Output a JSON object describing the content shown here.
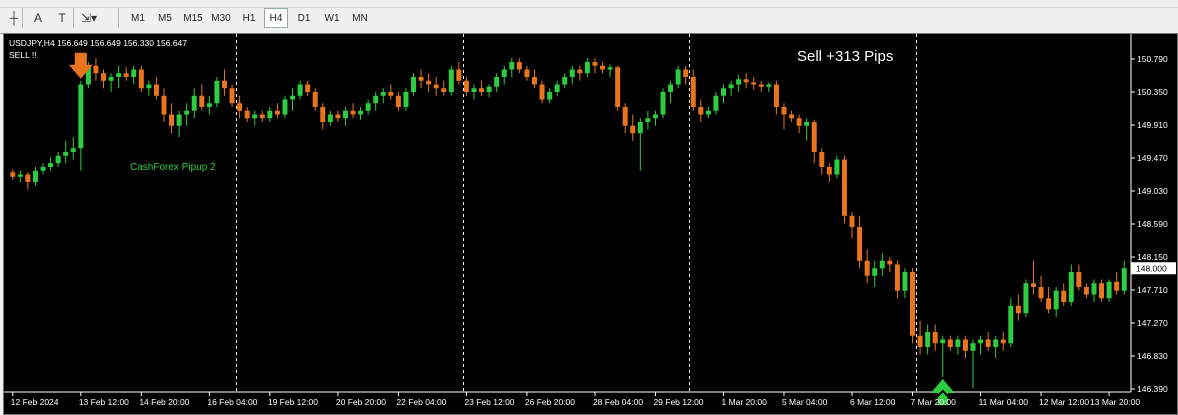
{
  "toolbar": {
    "tools": [
      {
        "name": "crosshair-tool-icon",
        "glyph": "┼"
      },
      {
        "name": "text-tool-icon",
        "glyph": "A"
      },
      {
        "name": "text-label-tool-icon",
        "glyph": "T"
      },
      {
        "name": "objects-dropdown-icon",
        "glyph": "⇲▾"
      }
    ],
    "timeframes": [
      "M1",
      "M5",
      "M15",
      "M30",
      "H1",
      "H4",
      "D1",
      "W1",
      "MN"
    ],
    "active_timeframe": "H4"
  },
  "chart": {
    "header": "USDJPY,H4  156.649 156.649 156.330 156.647",
    "signal_label": "SELL !!",
    "profit_label": "Sell +313 Pips",
    "indicator_label": "CashForex Pipup 2",
    "colors": {
      "background": "#000000",
      "bull": "#2ecc40",
      "bear": "#e8741e",
      "axis_text": "#ffffff",
      "separator": "#ffffff",
      "arrow_down": "#e8741e",
      "arrow_up": "#2ecc40",
      "indicator_text": "#2ecc40"
    }
  },
  "chart_data": {
    "type": "candlestick",
    "symbol": "USDJPY",
    "timeframe": "H4",
    "y_ticks": [
      "150.790",
      "150.350",
      "149.910",
      "149.470",
      "149.030",
      "148.590",
      "148.150",
      "147.710",
      "147.270",
      "146.830",
      "146.390"
    ],
    "ylim": [
      146.39,
      150.79
    ],
    "x_ticks": [
      "12 Feb 2024",
      "13 Feb 12:00",
      "14 Feb 20:00",
      "16 Feb 04:00",
      "19 Feb 12:00",
      "20 Feb 20:00",
      "22 Feb 04:00",
      "23 Feb 12:00",
      "26 Feb 20:00",
      "28 Feb 04:00",
      "29 Feb 12:00",
      "1 Mar 20:00",
      "5 Mar 04:00",
      "6 Mar 12:00",
      "7 Mar 20:00",
      "11 Mar 04:00",
      "12 Mar 12:00",
      "13 Mar 20:00"
    ],
    "grid": false,
    "candles": [
      [
        149.28,
        149.32,
        149.18,
        149.22
      ],
      [
        149.22,
        149.3,
        149.15,
        149.25
      ],
      [
        149.25,
        149.28,
        149.05,
        149.15
      ],
      [
        149.15,
        149.35,
        149.1,
        149.3
      ],
      [
        149.3,
        149.4,
        149.25,
        149.35
      ],
      [
        149.35,
        149.48,
        149.3,
        149.4
      ],
      [
        149.4,
        149.55,
        149.35,
        149.5
      ],
      [
        149.5,
        149.7,
        149.4,
        149.55
      ],
      [
        149.55,
        149.75,
        149.45,
        149.6
      ],
      [
        149.6,
        150.5,
        149.3,
        150.45
      ],
      [
        150.45,
        150.75,
        150.4,
        150.7
      ],
      [
        150.7,
        150.8,
        150.5,
        150.6
      ],
      [
        150.6,
        150.65,
        150.4,
        150.5
      ],
      [
        150.5,
        150.6,
        150.35,
        150.55
      ],
      [
        150.55,
        150.7,
        150.4,
        150.6
      ],
      [
        150.6,
        150.68,
        150.5,
        150.55
      ],
      [
        150.55,
        150.7,
        150.45,
        150.65
      ],
      [
        150.65,
        150.7,
        150.35,
        150.4
      ],
      [
        150.4,
        150.5,
        150.3,
        150.45
      ],
      [
        150.45,
        150.55,
        150.25,
        150.3
      ],
      [
        150.3,
        150.4,
        149.95,
        150.05
      ],
      [
        150.05,
        150.2,
        149.8,
        149.9
      ],
      [
        149.9,
        150.1,
        149.75,
        150.05
      ],
      [
        150.05,
        150.2,
        149.9,
        150.1
      ],
      [
        150.1,
        150.4,
        150.0,
        150.3
      ],
      [
        150.3,
        150.45,
        150.1,
        150.15
      ],
      [
        150.15,
        150.3,
        150.05,
        150.2
      ],
      [
        150.2,
        150.55,
        150.15,
        150.5
      ],
      [
        150.5,
        150.65,
        150.3,
        150.4
      ],
      [
        150.4,
        150.45,
        150.15,
        150.2
      ],
      [
        150.2,
        150.3,
        150.0,
        150.1
      ],
      [
        150.1,
        150.15,
        149.95,
        150.0
      ],
      [
        150.0,
        150.1,
        149.9,
        150.05
      ],
      [
        150.05,
        150.1,
        149.95,
        150.0
      ],
      [
        150.0,
        150.15,
        149.95,
        150.1
      ],
      [
        150.1,
        150.2,
        150.0,
        150.05
      ],
      [
        150.05,
        150.3,
        150.0,
        150.25
      ],
      [
        150.25,
        150.4,
        150.1,
        150.3
      ],
      [
        150.3,
        150.5,
        150.25,
        150.45
      ],
      [
        150.45,
        150.5,
        150.3,
        150.35
      ],
      [
        150.35,
        150.4,
        150.1,
        150.15
      ],
      [
        150.15,
        150.2,
        149.85,
        149.95
      ],
      [
        149.95,
        150.1,
        149.9,
        150.05
      ],
      [
        150.05,
        150.1,
        149.95,
        150.0
      ],
      [
        150.0,
        150.15,
        149.9,
        150.1
      ],
      [
        150.1,
        150.2,
        150.0,
        150.05
      ],
      [
        150.05,
        150.15,
        149.98,
        150.1
      ],
      [
        150.1,
        150.25,
        150.05,
        150.2
      ],
      [
        150.2,
        150.35,
        150.1,
        150.3
      ],
      [
        150.3,
        150.4,
        150.2,
        150.35
      ],
      [
        150.35,
        150.45,
        150.25,
        150.3
      ],
      [
        150.3,
        150.35,
        150.1,
        150.15
      ],
      [
        150.15,
        150.4,
        150.1,
        150.35
      ],
      [
        150.35,
        150.6,
        150.3,
        150.55
      ],
      [
        150.55,
        150.65,
        150.4,
        150.5
      ],
      [
        150.5,
        150.6,
        150.35,
        150.45
      ],
      [
        150.45,
        150.55,
        150.3,
        150.4
      ],
      [
        150.4,
        150.5,
        150.3,
        150.35
      ],
      [
        150.35,
        150.7,
        150.3,
        150.65
      ],
      [
        150.65,
        150.75,
        150.45,
        150.5
      ],
      [
        150.5,
        150.55,
        150.3,
        150.35
      ],
      [
        150.35,
        150.45,
        150.25,
        150.4
      ],
      [
        150.4,
        150.5,
        150.3,
        150.35
      ],
      [
        150.35,
        150.45,
        150.28,
        150.42
      ],
      [
        150.42,
        150.6,
        150.35,
        150.55
      ],
      [
        150.55,
        150.7,
        150.45,
        150.65
      ],
      [
        150.65,
        150.8,
        150.55,
        150.75
      ],
      [
        150.75,
        150.8,
        150.6,
        150.65
      ],
      [
        150.65,
        150.7,
        150.5,
        150.55
      ],
      [
        150.55,
        150.65,
        150.4,
        150.45
      ],
      [
        150.45,
        150.5,
        150.2,
        150.25
      ],
      [
        150.25,
        150.4,
        150.2,
        150.35
      ],
      [
        150.35,
        150.5,
        150.3,
        150.45
      ],
      [
        150.45,
        150.6,
        150.4,
        150.55
      ],
      [
        150.55,
        150.7,
        150.45,
        150.65
      ],
      [
        150.65,
        150.7,
        150.5,
        150.6
      ],
      [
        150.6,
        150.8,
        150.55,
        150.75
      ],
      [
        150.75,
        150.8,
        150.6,
        150.7
      ],
      [
        150.7,
        150.75,
        150.6,
        150.65
      ],
      [
        150.65,
        150.72,
        150.55,
        150.68
      ],
      [
        150.68,
        150.7,
        150.1,
        150.15
      ],
      [
        150.15,
        150.2,
        149.8,
        149.9
      ],
      [
        149.9,
        150.05,
        149.7,
        149.8
      ],
      [
        149.8,
        150.0,
        149.3,
        149.95
      ],
      [
        149.95,
        150.1,
        149.85,
        150.0
      ],
      [
        150.0,
        150.1,
        149.9,
        150.05
      ],
      [
        150.05,
        150.4,
        150.0,
        150.35
      ],
      [
        150.35,
        150.5,
        150.2,
        150.45
      ],
      [
        150.45,
        150.7,
        150.4,
        150.65
      ],
      [
        150.65,
        150.7,
        150.45,
        150.55
      ],
      [
        150.55,
        150.65,
        150.1,
        150.15
      ],
      [
        150.15,
        150.25,
        149.95,
        150.05
      ],
      [
        150.05,
        150.15,
        150.0,
        150.1
      ],
      [
        150.1,
        150.35,
        150.05,
        150.3
      ],
      [
        150.3,
        150.45,
        150.2,
        150.4
      ],
      [
        150.4,
        150.5,
        150.3,
        150.45
      ],
      [
        150.45,
        150.58,
        150.35,
        150.52
      ],
      [
        150.52,
        150.6,
        150.4,
        150.48
      ],
      [
        150.48,
        150.55,
        150.38,
        150.45
      ],
      [
        150.45,
        150.5,
        150.35,
        150.42
      ],
      [
        150.42,
        150.48,
        150.35,
        150.45
      ],
      [
        150.45,
        150.5,
        150.05,
        150.15
      ],
      [
        150.15,
        150.2,
        149.85,
        150.05
      ],
      [
        150.05,
        150.1,
        149.95,
        150.0
      ],
      [
        150.0,
        150.05,
        149.8,
        149.9
      ],
      [
        149.9,
        150.0,
        149.7,
        149.95
      ],
      [
        149.95,
        149.98,
        149.4,
        149.55
      ],
      [
        149.55,
        149.6,
        149.25,
        149.35
      ],
      [
        149.35,
        149.4,
        149.15,
        149.25
      ],
      [
        149.25,
        149.5,
        149.2,
        149.45
      ],
      [
        149.45,
        149.5,
        148.6,
        148.7
      ],
      [
        148.7,
        148.75,
        148.4,
        148.55
      ],
      [
        148.55,
        148.7,
        148.0,
        148.1
      ],
      [
        148.1,
        148.25,
        147.8,
        147.9
      ],
      [
        147.9,
        148.1,
        147.75,
        148.0
      ],
      [
        148.0,
        148.2,
        147.9,
        148.1
      ],
      [
        148.1,
        148.15,
        147.95,
        148.05
      ],
      [
        148.05,
        148.1,
        147.6,
        147.7
      ],
      [
        147.7,
        148.0,
        147.6,
        147.95
      ],
      [
        147.95,
        148.0,
        147.0,
        147.1
      ],
      [
        147.1,
        147.3,
        146.85,
        146.95
      ],
      [
        146.95,
        147.25,
        146.85,
        147.15
      ],
      [
        147.15,
        147.25,
        146.9,
        147.0
      ],
      [
        147.0,
        147.1,
        146.55,
        147.05
      ],
      [
        147.05,
        147.1,
        146.9,
        146.95
      ],
      [
        146.95,
        147.1,
        146.85,
        147.05
      ],
      [
        147.05,
        147.1,
        146.8,
        146.9
      ],
      [
        146.9,
        147.05,
        146.4,
        147.0
      ],
      [
        147.0,
        147.1,
        146.85,
        147.05
      ],
      [
        147.05,
        147.15,
        146.9,
        146.95
      ],
      [
        146.95,
        147.1,
        146.8,
        147.05
      ],
      [
        147.05,
        147.15,
        146.9,
        147.0
      ],
      [
        147.0,
        147.6,
        146.95,
        147.5
      ],
      [
        147.5,
        147.65,
        147.3,
        147.4
      ],
      [
        147.4,
        147.85,
        147.35,
        147.8
      ],
      [
        147.8,
        148.1,
        147.65,
        147.75
      ],
      [
        147.75,
        147.9,
        147.55,
        147.6
      ],
      [
        147.6,
        147.75,
        147.4,
        147.45
      ],
      [
        147.45,
        147.75,
        147.35,
        147.7
      ],
      [
        147.7,
        147.8,
        147.5,
        147.55
      ],
      [
        147.55,
        148.05,
        147.5,
        147.95
      ],
      [
        147.95,
        148.05,
        147.7,
        147.75
      ],
      [
        147.75,
        147.8,
        147.6,
        147.65
      ],
      [
        147.65,
        147.85,
        147.55,
        147.8
      ],
      [
        147.8,
        147.85,
        147.55,
        147.6
      ],
      [
        147.6,
        147.85,
        147.55,
        147.82
      ],
      [
        147.82,
        147.95,
        147.65,
        147.7
      ],
      [
        147.7,
        148.1,
        147.65,
        148.0
      ]
    ],
    "signals": [
      {
        "type": "sell",
        "candle_index": 9
      },
      {
        "type": "buy",
        "candle_index": 123
      }
    ],
    "period_separators_after_candle": [
      30,
      60,
      90,
      120
    ]
  }
}
